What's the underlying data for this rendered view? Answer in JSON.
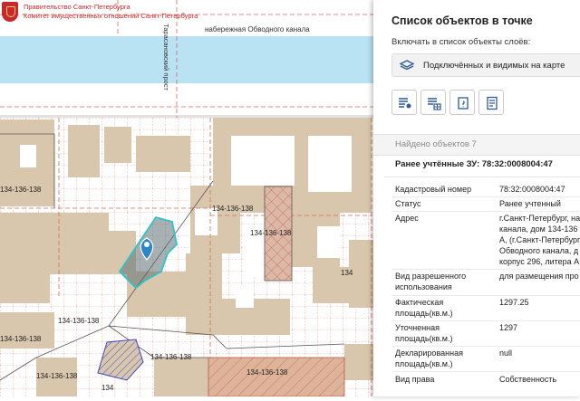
{
  "map": {
    "logo_line1": "Правительство Санкт-Петербурга",
    "logo_line2": "Комитет имущественных отношений Санкт-Петербурга",
    "embankment_label": "набережная Обводного канала",
    "street_label": "Тарасановский прост",
    "parcel_labels": [
      "134-136-138",
      "134-136-138",
      "134-136-138",
      "134-136-138",
      "134-136-138",
      "134-136-138",
      "134-136-138",
      "134",
      "134",
      "134-136-138"
    ]
  },
  "panel": {
    "title": "Список объектов в точке",
    "subtitle": "Включать в список объекты слоёв:",
    "layer_select": "Подключённых и видимых на карте",
    "found": "Найдено объектов 7",
    "object_title": "Ранее учтённые ЗУ: 78:32:0008004:47",
    "attributes": [
      {
        "key": "Кадастровый номер",
        "value": "78:32:0008004:47"
      },
      {
        "key": "Статус",
        "value": "Ранее учтенный"
      },
      {
        "key": "Адрес",
        "value": "г.Санкт-Петербург, на\nканала, дом 134-136\nА, (г.Санкт-Петербург\nОбводного канала, д\nкорпус 296, литера А"
      },
      {
        "key": "Вид разрешенного\nиспользования",
        "value": "для размещения про"
      },
      {
        "key": "Фактическая\nплощадь(кв.м.)",
        "value": "1297.25"
      },
      {
        "key": "Уточненная\nплощадь(кв.м.)",
        "value": "1297"
      },
      {
        "key": "Декларированная\nплощадь(кв.м.)",
        "value": "null"
      },
      {
        "key": "Вид права",
        "value": "Собственность"
      }
    ]
  },
  "colors": {
    "building": "#d9c7ad",
    "water": "#b9e2f2",
    "parcel_line": "#d36b5a",
    "selected_outline": "#2ec4c9",
    "marker": "#2a86c8",
    "accent_icon": "#2f5b9a"
  },
  "icons": {
    "logo": "spb-emblem",
    "layer_select": "layers-icon",
    "tools": [
      "list-marker-icon",
      "list-grid-icon",
      "frame-icon",
      "document-icon"
    ],
    "marker": "map-pin-icon"
  }
}
